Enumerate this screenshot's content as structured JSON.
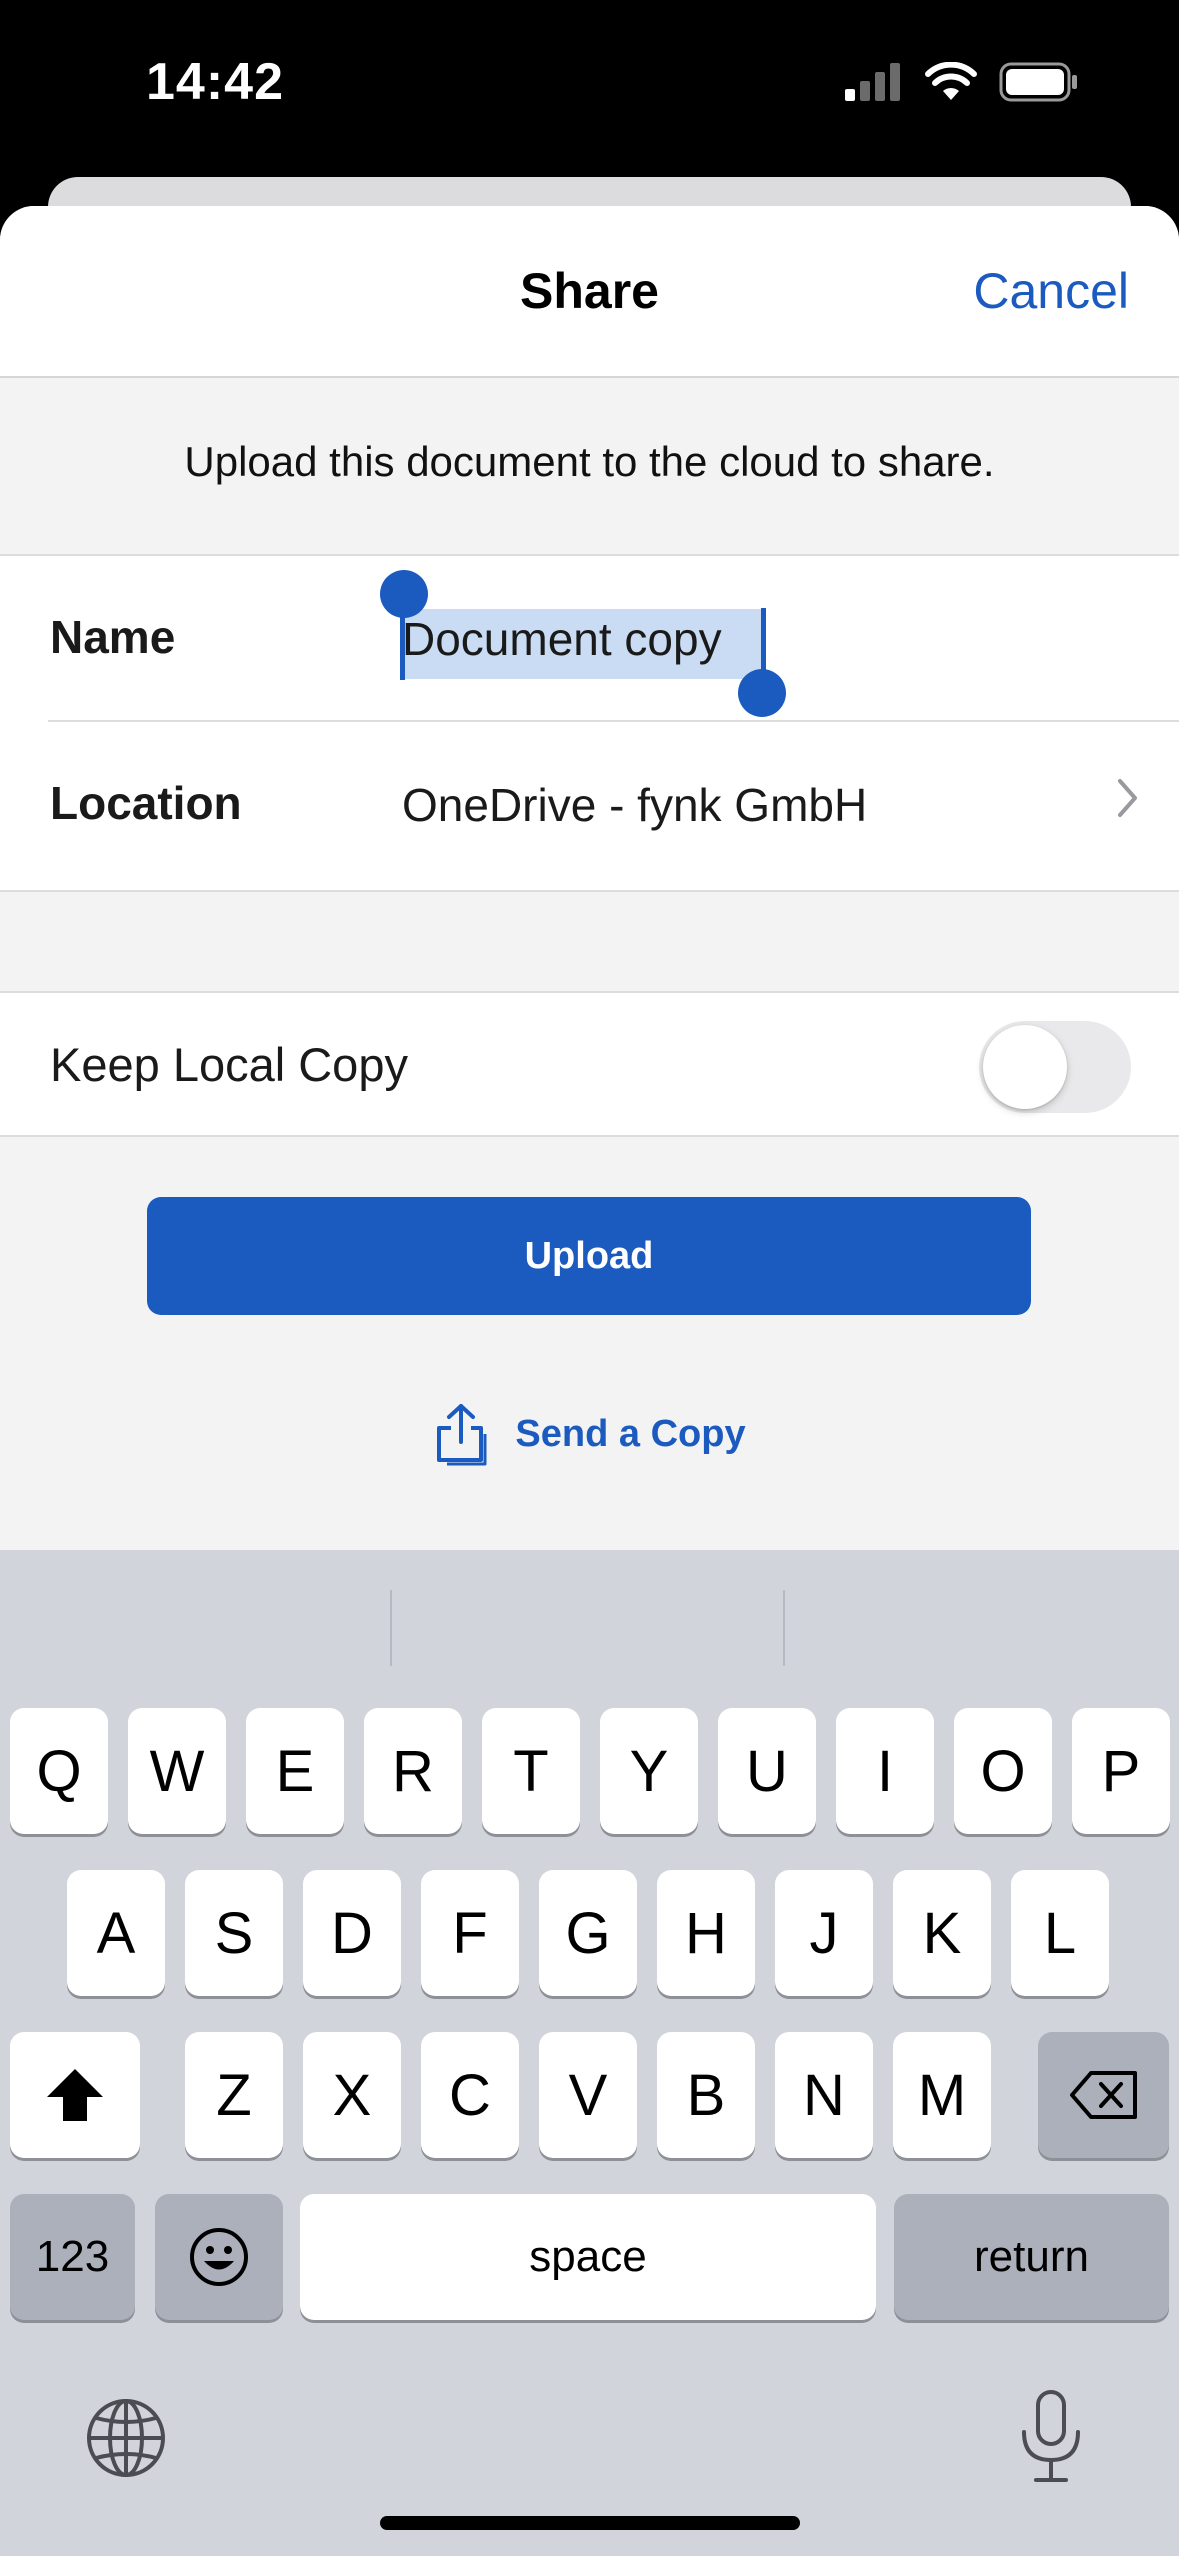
{
  "status_bar": {
    "time": "14:42"
  },
  "sheet": {
    "title": "Share",
    "cancel_label": "Cancel",
    "message": "Upload this document to the cloud to share.",
    "name_label": "Name",
    "name_value": "Document copy",
    "location_label": "Location",
    "location_value": "OneDrive - fynk GmbH",
    "keep_local_copy_label": "Keep Local Copy",
    "keep_local_copy_on": false,
    "upload_label": "Upload",
    "send_copy_label": "Send a Copy"
  },
  "keyboard": {
    "row1": [
      "Q",
      "W",
      "E",
      "R",
      "T",
      "Y",
      "U",
      "I",
      "O",
      "P"
    ],
    "row2": [
      "A",
      "S",
      "D",
      "F",
      "G",
      "H",
      "J",
      "K",
      "L"
    ],
    "row3": [
      "Z",
      "X",
      "C",
      "V",
      "B",
      "N",
      "M"
    ],
    "numbers_label": "123",
    "space_label": "space",
    "return_label": "return"
  },
  "colors": {
    "accent": "#1b5bbf",
    "selection": "#c9dcf3",
    "keyboard_bg": "#d1d4db"
  },
  "icons": [
    "cellular-signal-icon",
    "wifi-icon",
    "battery-icon",
    "chevron-right-icon",
    "share-icon",
    "shift-icon",
    "delete-icon",
    "emoji-icon",
    "globe-icon",
    "microphone-icon"
  ]
}
